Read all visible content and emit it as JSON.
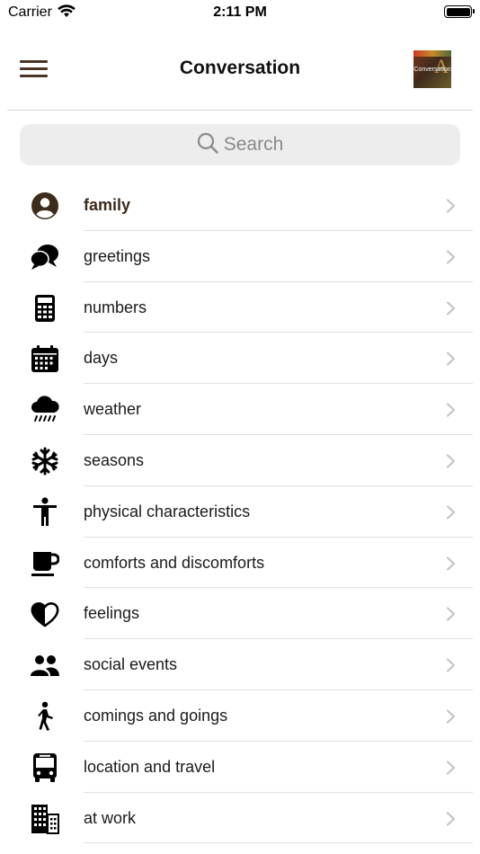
{
  "status_bar": {
    "carrier": "Carrier",
    "time": "2:11 PM"
  },
  "header": {
    "title": "Conversation",
    "logo_text": "Conversation"
  },
  "search": {
    "placeholder": "Search"
  },
  "list": {
    "items": [
      {
        "label": "family",
        "icon": "person-circle-icon",
        "active": true
      },
      {
        "label": "greetings",
        "icon": "speech-bubbles-icon"
      },
      {
        "label": "numbers",
        "icon": "calculator-icon"
      },
      {
        "label": "days",
        "icon": "calendar-icon"
      },
      {
        "label": "weather",
        "icon": "cloud-rain-icon"
      },
      {
        "label": "seasons",
        "icon": "snowflake-icon"
      },
      {
        "label": "physical characteristics",
        "icon": "human-figure-icon"
      },
      {
        "label": "comforts and discomforts",
        "icon": "coffee-cup-icon"
      },
      {
        "label": "feelings",
        "icon": "half-heart-icon"
      },
      {
        "label": "social events",
        "icon": "people-icon"
      },
      {
        "label": "comings and goings",
        "icon": "walking-person-icon"
      },
      {
        "label": "location and travel",
        "icon": "bus-icon"
      },
      {
        "label": "at work",
        "icon": "buildings-icon"
      }
    ]
  },
  "colors": {
    "accent": "#3d2b1c",
    "menu": "#4a3526",
    "chevron": "#c4c4c6",
    "search_bg": "#ededed"
  }
}
